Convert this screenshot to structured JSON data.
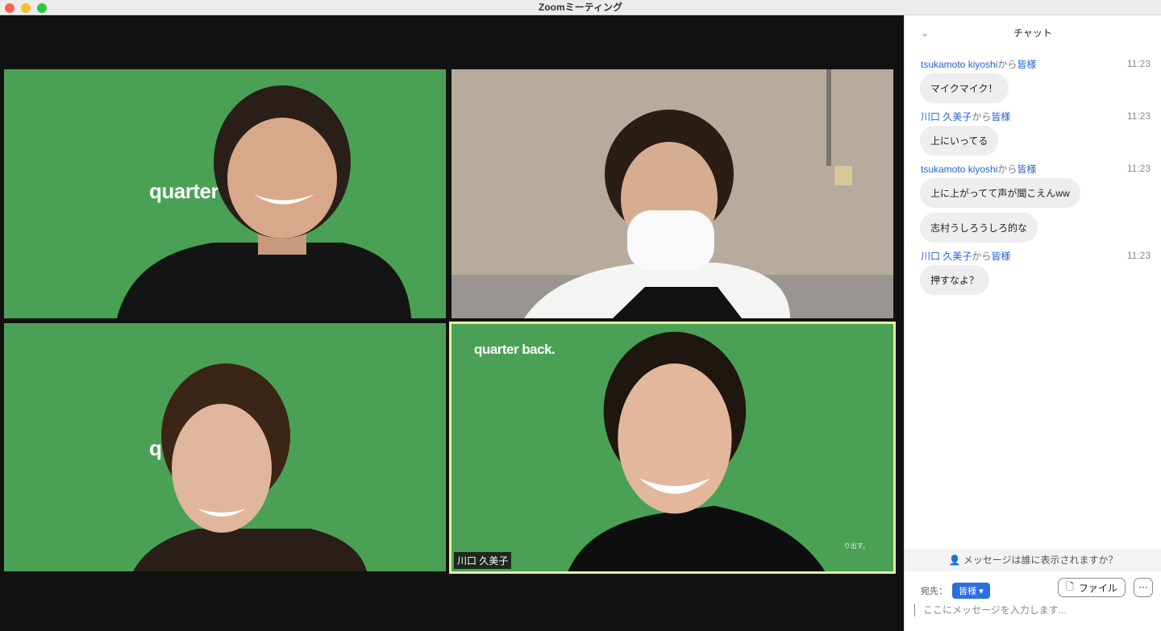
{
  "window": {
    "title": "Zoomミーティング"
  },
  "video": {
    "logo": "quarter back.",
    "active_speaker": "川口 久美子",
    "small_caption": "り出す。"
  },
  "chat": {
    "title": "チャット",
    "from": "から",
    "messages": [
      {
        "sender": "tsukamoto kiyoshi",
        "to": "皆様",
        "time": "11:23",
        "texts": [
          "マイクマイク！"
        ]
      },
      {
        "sender": "川口 久美子",
        "to": "皆様",
        "time": "11:23",
        "texts": [
          "上にいってる"
        ]
      },
      {
        "sender": "tsukamoto kiyoshi",
        "to": "皆様",
        "time": "11:23",
        "texts": [
          "上に上がってて声が聞こえんww",
          "志村うしろうしろ的な"
        ]
      },
      {
        "sender": "川口 久美子",
        "to": "皆様",
        "time": "11:23",
        "texts": [
          "押すなよ？"
        ]
      }
    ],
    "visibility_prompt": "メッセージは誰に表示されますか？",
    "to_label": "宛先：",
    "to_value": "皆様",
    "file_label": "ファイル",
    "more_label": "···",
    "input_placeholder": "ここにメッセージを入力します..."
  }
}
